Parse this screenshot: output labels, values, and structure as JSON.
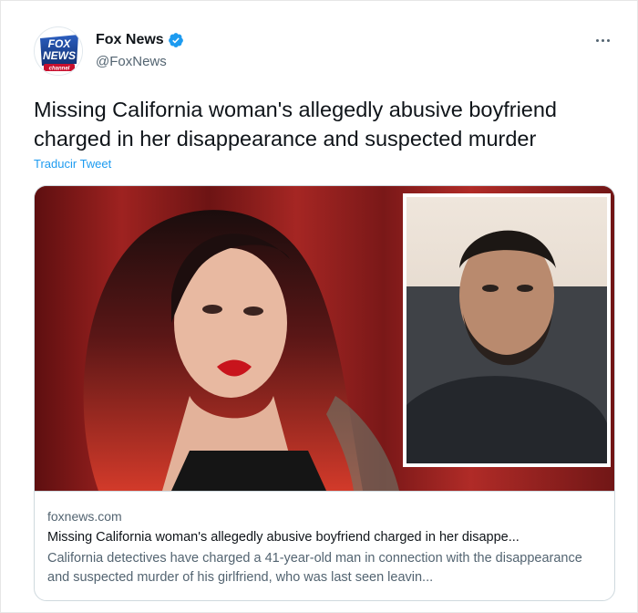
{
  "tweet": {
    "author_name": "Fox News",
    "author_handle": "@FoxNews",
    "text": "Missing California woman's allegedly abusive boyfriend charged in her disappearance and suspected murder",
    "translate_label": "Traducir Tweet",
    "verified": true
  },
  "avatar": {
    "logo_line1": "FOX",
    "logo_line2": "NEWS",
    "logo_line3": "channel"
  },
  "icons": {
    "more": "more-options-icon",
    "verified": "verified-badge-icon"
  },
  "link_card": {
    "domain": "foxnews.com",
    "title": "Missing California woman's allegedly abusive boyfriend charged in her disappe...",
    "description": "California detectives have charged a 41-year-old man in connection with the disappearance and suspected murder of his girlfriend, who was last seen leavin..."
  },
  "colors": {
    "accent": "#1d9bf0",
    "text_primary": "#0f1419",
    "text_secondary": "#536471",
    "border": "#cfd9de",
    "fox_blue": "#1a3f8f",
    "fox_red": "#c8102e"
  }
}
